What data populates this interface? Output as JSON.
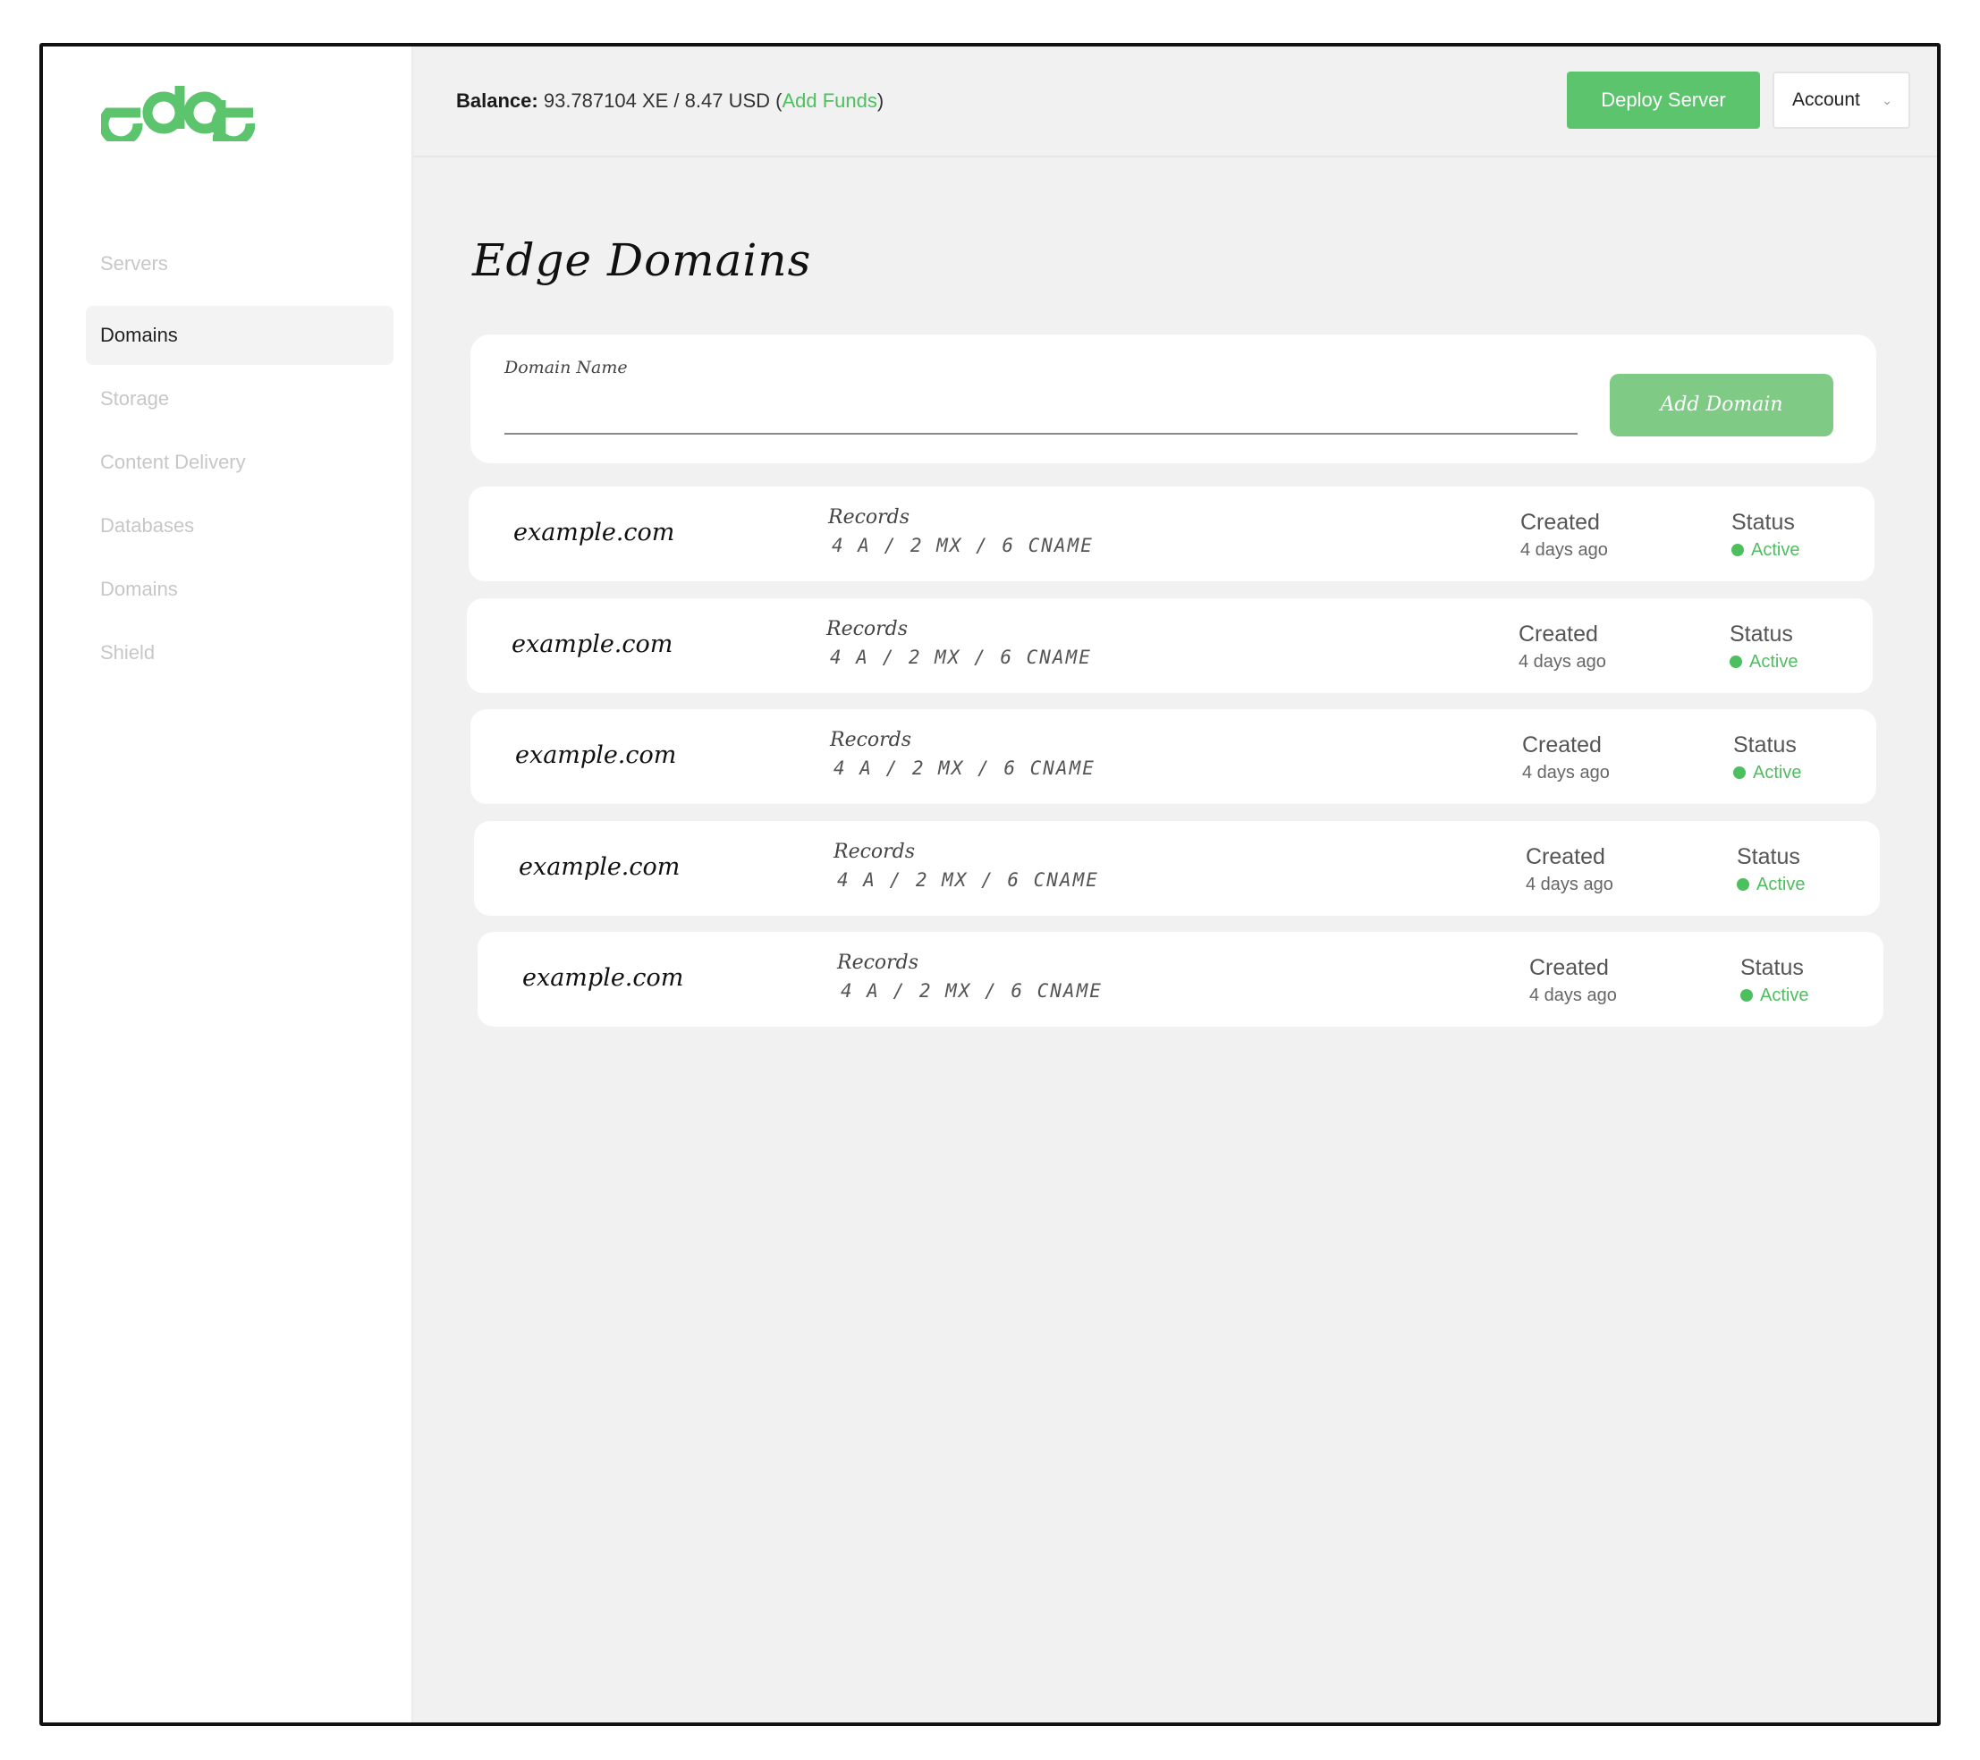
{
  "brand": {
    "logo_text": "edge",
    "color": "#5cc46c"
  },
  "sidebar": {
    "items": [
      {
        "label": "Servers",
        "active": false
      },
      {
        "label": "Domains",
        "active": true
      },
      {
        "label": "Storage",
        "active": false
      },
      {
        "label": "Content Delivery",
        "active": false
      },
      {
        "label": "Databases",
        "active": false
      },
      {
        "label": "Domains",
        "active": false
      },
      {
        "label": "Shield",
        "active": false
      }
    ]
  },
  "header": {
    "balance_label": "Balance:",
    "balance_value": "93.787104 XE / 8.47 USD",
    "add_funds": "Add Funds",
    "deploy_button": "Deploy Server",
    "account_button": "Account",
    "account_icon": "chevron-down-icon"
  },
  "page": {
    "title": "Edge Domains"
  },
  "add_form": {
    "label": "Domain Name",
    "input_value": "",
    "placeholder": "",
    "button": "Add Domain"
  },
  "domains": [
    {
      "name": "example.com",
      "records_label": "Records",
      "records": "4 A / 2 MX / 6 CNAME",
      "created_label": "Created",
      "created": "4 days ago",
      "status_label": "Status",
      "status": "Active"
    },
    {
      "name": "example.com",
      "records_label": "Records",
      "records": "4 A / 2 MX / 6 CNAME",
      "created_label": "Created",
      "created": "4 days ago",
      "status_label": "Status",
      "status": "Active"
    },
    {
      "name": "example.com",
      "records_label": "Records",
      "records": "4 A / 2 MX / 6 CNAME",
      "created_label": "Created",
      "created": "4 days ago",
      "status_label": "Status",
      "status": "Active"
    },
    {
      "name": "example.com",
      "records_label": "Records",
      "records": "4 A / 2 MX / 6 CNAME",
      "created_label": "Created",
      "created": "4 days ago",
      "status_label": "Status",
      "status": "Active"
    },
    {
      "name": "example.com",
      "records_label": "Records",
      "records": "4 A / 2 MX / 6 CNAME",
      "created_label": "Created",
      "created": "4 days ago",
      "status_label": "Status",
      "status": "Active"
    }
  ],
  "colors": {
    "accent": "#5cc46c",
    "status_active": "#4cbf5e"
  }
}
